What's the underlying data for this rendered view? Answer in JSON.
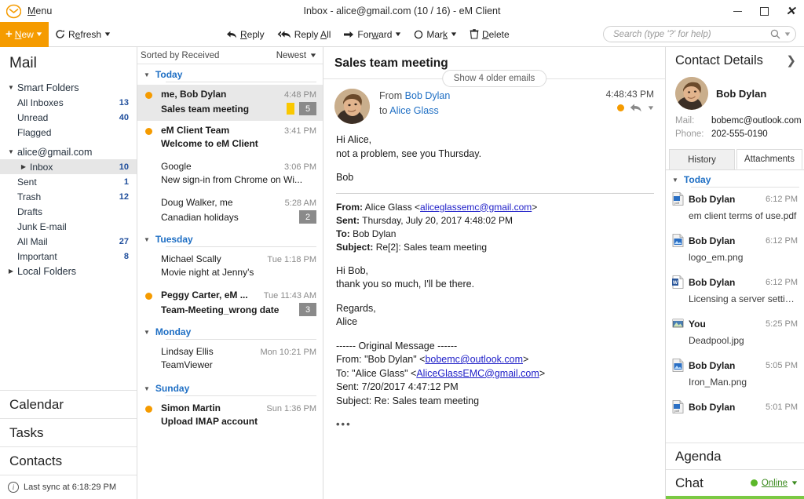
{
  "window": {
    "menu_label": "Menu",
    "title": "Inbox - alice@gmail.com (10 / 16) - eM Client",
    "minimize": "minimize-button",
    "maximize": "maximize-button",
    "close": "close-button"
  },
  "toolbar": {
    "new_label": "New",
    "refresh_label": "Refresh",
    "reply_label": "Reply",
    "reply_all_label": "Reply All",
    "forward_label": "Forward",
    "mark_label": "Mark",
    "delete_label": "Delete",
    "search_placeholder": "Search (type '?' for help)",
    "search_value": ""
  },
  "sidebar": {
    "header": "Mail",
    "groups": [
      {
        "label": "Smart Folders",
        "expanded": true,
        "items": [
          {
            "label": "All Inboxes",
            "count": "13"
          },
          {
            "label": "Unread",
            "count": "40"
          },
          {
            "label": "Flagged",
            "count": ""
          }
        ]
      },
      {
        "label": "alice@gmail.com",
        "expanded": true,
        "items": [
          {
            "label": "Inbox",
            "count": "10",
            "selected": true,
            "has_children": true
          },
          {
            "label": "Sent",
            "count": "1"
          },
          {
            "label": "Trash",
            "count": "12"
          },
          {
            "label": "Drafts",
            "count": ""
          },
          {
            "label": "Junk E-mail",
            "count": ""
          },
          {
            "label": "All Mail",
            "count": "27"
          },
          {
            "label": "Important",
            "count": "8"
          }
        ]
      },
      {
        "label": "Local Folders",
        "expanded": false,
        "items": []
      }
    ],
    "nav": [
      "Calendar",
      "Tasks",
      "Contacts"
    ],
    "sync_status": "Last sync at 6:18:29 PM"
  },
  "message_list": {
    "sorted_by": "Sorted by Received",
    "order": "Newest",
    "groups": [
      {
        "label": "Today",
        "messages": [
          {
            "sender": "me, Bob Dylan",
            "subject": "Sales team meeting",
            "time": "4:48 PM",
            "unread": true,
            "selected": true,
            "flag": true,
            "count": "5"
          },
          {
            "sender": "eM Client Team",
            "subject": "Welcome to eM Client",
            "time": "3:41 PM",
            "unread": true,
            "selected": false,
            "flag": false,
            "count": ""
          },
          {
            "sender": "Google",
            "subject": "New sign-in from Chrome on Wi...",
            "time": "3:06 PM",
            "unread": false,
            "selected": false,
            "flag": false,
            "count": ""
          },
          {
            "sender": "Doug Walker, me",
            "subject": "Canadian holidays",
            "time": "5:28 AM",
            "unread": false,
            "selected": false,
            "flag": false,
            "count": "2"
          }
        ]
      },
      {
        "label": "Tuesday",
        "messages": [
          {
            "sender": "Michael Scally",
            "subject": "Movie night at Jenny's",
            "time": "Tue 1:18 PM",
            "unread": false,
            "selected": false,
            "flag": false,
            "count": ""
          },
          {
            "sender": "Peggy Carter, eM ...",
            "subject": "Team-Meeting_wrong date",
            "time": "Tue 11:43 AM",
            "unread": true,
            "selected": false,
            "flag": false,
            "count": "3"
          }
        ]
      },
      {
        "label": "Monday",
        "messages": [
          {
            "sender": "Lindsay Ellis",
            "subject": "TeamViewer",
            "time": "Mon 10:21 PM",
            "unread": false,
            "selected": false,
            "flag": false,
            "count": ""
          }
        ]
      },
      {
        "label": "Sunday",
        "messages": [
          {
            "sender": "Simon Martin",
            "subject": "Upload IMAP account",
            "time": "Sun 1:36 PM",
            "unread": true,
            "selected": false,
            "flag": false,
            "count": ""
          }
        ]
      }
    ]
  },
  "reader": {
    "subject": "Sales team meeting",
    "show_older": "Show 4 older emails",
    "from_prefix": "From",
    "from_name": "Bob Dylan",
    "to_prefix": "to",
    "to_name": "Alice Glass",
    "time": "4:48:43 PM",
    "body_line1": "Hi Alice,",
    "body_line2": "not a problem, see you Thursday.",
    "body_line3": "Bob",
    "quote1": {
      "from_label": "From:",
      "from_value": "Alice Glass <",
      "from_link": "aliceglassemc@gmail.com",
      "from_close": ">",
      "sent_label": "Sent:",
      "sent_value": "Thursday, July 20, 2017 4:48:02 PM",
      "to_label": "To:",
      "to_value": "Bob Dylan",
      "subject_label": "Subject:",
      "subject_value": "Re[2]: Sales team meeting",
      "text1": "Hi Bob,",
      "text2": "thank you so much, I'll be there.",
      "text3": "Regards,",
      "text4": "Alice"
    },
    "quote2": {
      "divider": "------ Original Message ------",
      "from_prefix": "From: \"Bob Dylan\" <",
      "from_link": "bobemc@outlook.com",
      "from_close": ">",
      "to_prefix": "To: \"Alice Glass\" <",
      "to_link": "AliceGlassEMC@gmail.com",
      "to_close": ">",
      "sent": "Sent: 7/20/2017 4:47:12 PM",
      "subject": "Subject: Re: Sales team meeting",
      "ellipsis": "•••"
    }
  },
  "contact_panel": {
    "title": "Contact Details",
    "name": "Bob Dylan",
    "mail_label": "Mail:",
    "mail_value": "bobemc@outlook.com",
    "phone_label": "Phone:",
    "phone_value": "202-555-0190",
    "tabs": [
      {
        "label": "History",
        "active": false
      },
      {
        "label": "Attachments",
        "active": true
      }
    ],
    "attachments_group": "Today",
    "attachments": [
      {
        "who": "Bob Dylan",
        "time": "6:12 PM",
        "file": "em client terms of use.pdf",
        "type": "pdf"
      },
      {
        "who": "Bob Dylan",
        "time": "6:12 PM",
        "file": "logo_em.png",
        "type": "png"
      },
      {
        "who": "Bob Dylan",
        "time": "6:12 PM",
        "file": "Licensing a server settings....",
        "type": "doc"
      },
      {
        "who": "You",
        "time": "5:25 PM",
        "file": "Deadpool.jpg",
        "type": "jpg"
      },
      {
        "who": "Bob Dylan",
        "time": "5:05 PM",
        "file": "Iron_Man.png",
        "type": "png"
      },
      {
        "who": "Bob Dylan",
        "time": "5:01 PM",
        "file": "",
        "type": "pdf"
      }
    ],
    "agenda_title": "Agenda",
    "chat_title": "Chat",
    "chat_status": "Online"
  },
  "colors": {
    "accent_orange": "#f59b00",
    "link_blue": "#1f6fc4",
    "chat_green": "#5cb82a",
    "flag_yellow": "#fac800"
  }
}
